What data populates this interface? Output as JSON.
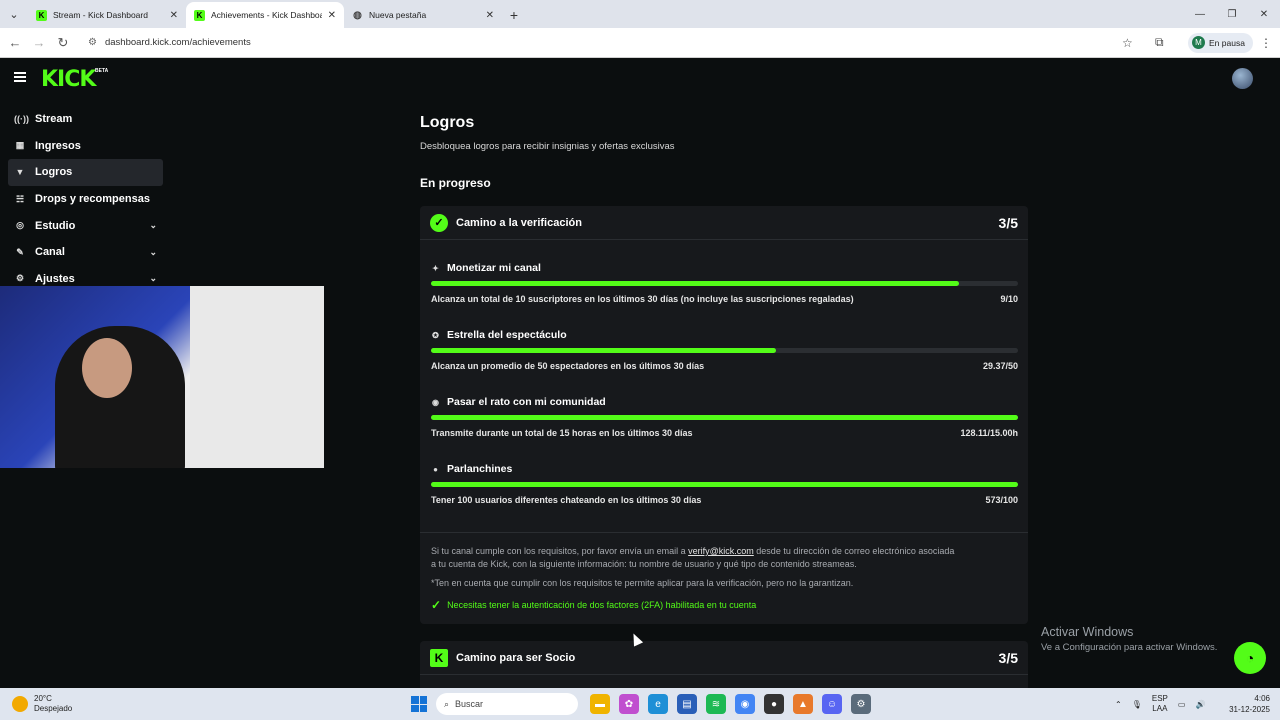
{
  "browser": {
    "tabs": [
      {
        "title": "Stream - Kick Dashboard",
        "active": false
      },
      {
        "title": "Achievements - Kick Dashboard",
        "active": true
      },
      {
        "title": "Nueva pestaña",
        "active": false
      }
    ],
    "url": "dashboard.kick.com/achievements",
    "profile_initial": "M",
    "profile_status": "En pausa"
  },
  "brand": {
    "logo": "KICK",
    "logo_badge": "BETA",
    "accent": "#53fc18"
  },
  "sidebar": {
    "items": [
      {
        "label": "Stream",
        "icon": "broadcast-icon",
        "glyph": "((·))",
        "expandable": false,
        "active": false
      },
      {
        "label": "Ingresos",
        "icon": "income-icon",
        "glyph": "▦",
        "expandable": false,
        "active": false
      },
      {
        "label": "Logros",
        "icon": "trophy-icon",
        "glyph": "🏆",
        "expandable": false,
        "active": true
      },
      {
        "label": "Drops y recompensas",
        "icon": "gift-icon",
        "glyph": "☵",
        "expandable": false,
        "active": false
      },
      {
        "label": "Estudio",
        "icon": "studio-icon",
        "glyph": "◎",
        "expandable": true,
        "active": false
      },
      {
        "label": "Canal",
        "icon": "channel-icon",
        "glyph": "✎",
        "expandable": true,
        "active": false
      },
      {
        "label": "Ajustes",
        "icon": "gear-icon",
        "glyph": "⚙",
        "expandable": true,
        "active": false
      }
    ]
  },
  "main": {
    "title": "Logros",
    "subtitle": "Desbloquea logros para recibir insignias y ofertas exclusivas",
    "section_title": "En progreso",
    "cards": [
      {
        "title": "Camino a la verificación",
        "score": "3/5",
        "tasks": [
          {
            "name": "Monetizar mi canal",
            "description": "Alcanza un total de 10 suscriptores en los últimos 30 días (no incluye las suscripciones regaladas)",
            "value": "9/10",
            "progress": 0.9
          },
          {
            "name": "Estrella del espectáculo",
            "description": "Alcanza un promedio de 50 espectadores en los últimos 30 días",
            "value": "29.37/50",
            "progress": 0.5874
          },
          {
            "name": "Pasar el rato con mi comunidad",
            "description": "Transmite durante un total de 15 horas en los últimos 30 días",
            "value": "128.11/15.00h",
            "progress": 1.0
          },
          {
            "name": "Parlanchines",
            "description": "Tener 100 usuarios diferentes chateando en los últimos 30 días",
            "value": "573/100",
            "progress": 1.0
          }
        ],
        "note_line1_before": "Si tu canal cumple con los requisitos, por favor envía un email a ",
        "note_email": "verify@kick.com",
        "note_line1_after": " desde tu dirección de correo electrónico asociada",
        "note_line2": "a tu cuenta de Kick, con la siguiente información: tu nombre de usuario y qué tipo de contenido streameas.",
        "note_line3": "*Ten en cuenta que cumplir con los requisitos te permite aplicar para la verificación, pero no la garantizan.",
        "requirement": "Necesitas tener la autenticación de dos factores (2FA) habilitada en tu cuenta"
      },
      {
        "title": "Camino para ser Socio",
        "score": "3/5"
      }
    ]
  },
  "watermark": {
    "line1": "Activar Windows",
    "line2": "Ve a Configuración para activar Windows."
  },
  "taskbar": {
    "weather_temp": "20°C",
    "weather_desc": "Despejado",
    "search_placeholder": "Buscar",
    "lang": "ESP",
    "lang_sub": "LAA",
    "time": "4:06",
    "date": "31-12-2025"
  }
}
